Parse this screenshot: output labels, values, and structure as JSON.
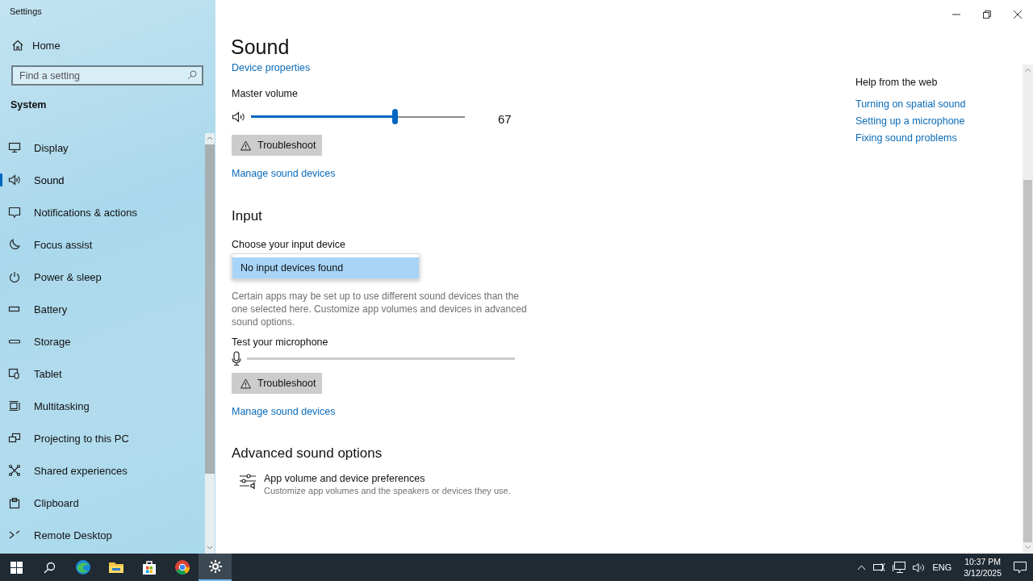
{
  "window": {
    "title": "Settings"
  },
  "sidebar": {
    "home": "Home",
    "search": {
      "placeholder": "Find a setting"
    },
    "section": "System",
    "items": [
      {
        "label": "Display",
        "selected": false
      },
      {
        "label": "Sound",
        "selected": true
      },
      {
        "label": "Notifications & actions",
        "selected": false
      },
      {
        "label": "Focus assist",
        "selected": false
      },
      {
        "label": "Power & sleep",
        "selected": false
      },
      {
        "label": "Battery",
        "selected": false
      },
      {
        "label": "Storage",
        "selected": false
      },
      {
        "label": "Tablet",
        "selected": false
      },
      {
        "label": "Multitasking",
        "selected": false
      },
      {
        "label": "Projecting to this PC",
        "selected": false
      },
      {
        "label": "Shared experiences",
        "selected": false
      },
      {
        "label": "Clipboard",
        "selected": false
      },
      {
        "label": "Remote Desktop",
        "selected": false
      }
    ]
  },
  "page": {
    "title": "Sound",
    "device_properties_link": "Device properties",
    "master_volume": {
      "label": "Master volume",
      "level": 0.67,
      "reading": "67"
    },
    "output_troubleshoot": "Troubleshoot",
    "output_manage_link": "Manage sound devices",
    "input": {
      "heading": "Input",
      "choose_label": "Choose your input device",
      "dropdown_options": [
        {
          "label": "No input devices found",
          "selected": true
        }
      ],
      "note": "Certain apps may be set up to use different sound devices than the one selected here. Customize app volumes and devices in advanced sound options.",
      "test_label": "Test your microphone",
      "mic_meter": {
        "level": 0
      },
      "troubleshoot": "Troubleshoot",
      "manage_link": "Manage sound devices"
    },
    "advanced": {
      "heading": "Advanced sound options",
      "items": [
        {
          "title": "App volume and device preferences",
          "description": "Customize app volumes and the speakers or devices they use."
        }
      ]
    }
  },
  "help": {
    "heading": "Help from the web",
    "links": [
      "Turning on spatial sound",
      "Setting up a microphone",
      "Fixing sound problems"
    ]
  },
  "taskbar": {
    "apps": [
      {
        "selected": false
      },
      {
        "selected": false
      },
      {
        "selected": false
      },
      {
        "selected": false
      },
      {
        "selected": true
      }
    ],
    "language": "ENG",
    "time": "10:37 PM",
    "date": "3/12/2025"
  }
}
